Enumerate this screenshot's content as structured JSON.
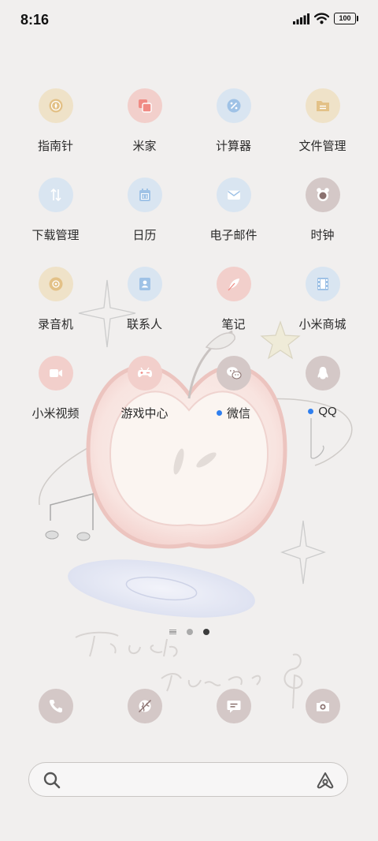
{
  "status_bar": {
    "time": "8:16",
    "battery": "100"
  },
  "apps": [
    {
      "name": "compass",
      "label": "指南针",
      "icon": "compass-icon",
      "bg": "#efe2c8",
      "fg": "#e3c187",
      "dot": false
    },
    {
      "name": "mi-home",
      "label": "米家",
      "icon": "mi-home-icon",
      "bg": "#f2cfcb",
      "fg": "#f08b84",
      "dot": false
    },
    {
      "name": "calculator",
      "label": "计算器",
      "icon": "calculator-icon",
      "bg": "#d9e5f1",
      "fg": "#9fc2e6",
      "dot": false
    },
    {
      "name": "file-manager",
      "label": "文件管理",
      "icon": "folder-icon",
      "bg": "#efe2c8",
      "fg": "#e3c187",
      "dot": false
    },
    {
      "name": "download-manager",
      "label": "下载管理",
      "icon": "download-icon",
      "bg": "#d9e5f1",
      "fg": "#9fc2e6",
      "dot": false
    },
    {
      "name": "calendar",
      "label": "日历",
      "icon": "calendar-icon",
      "bg": "#d9e5f1",
      "fg": "#9fc2e6",
      "dot": false
    },
    {
      "name": "email",
      "label": "电子邮件",
      "icon": "mail-icon",
      "bg": "#d9e5f1",
      "fg": "#9fc2e6",
      "dot": false
    },
    {
      "name": "clock",
      "label": "时钟",
      "icon": "alarm-clock-icon",
      "bg": "#d4c8c7",
      "fg": "#8b7270",
      "dot": false
    },
    {
      "name": "recorder",
      "label": "录音机",
      "icon": "recorder-icon",
      "bg": "#efe2c8",
      "fg": "#e3c187",
      "dot": false
    },
    {
      "name": "contacts",
      "label": "联系人",
      "icon": "contacts-icon",
      "bg": "#d9e5f1",
      "fg": "#9fc2e6",
      "dot": false
    },
    {
      "name": "notes",
      "label": "笔记",
      "icon": "feather-icon",
      "bg": "#f2cfcb",
      "fg": "#f08b84",
      "dot": false
    },
    {
      "name": "mi-store",
      "label": "小米商城",
      "icon": "film-icon",
      "bg": "#d9e5f1",
      "fg": "#9fc2e6",
      "dot": false
    },
    {
      "name": "mi-video",
      "label": "小米视频",
      "icon": "video-camera-icon",
      "bg": "#f2cfcb",
      "fg": "#f08b84",
      "dot": false
    },
    {
      "name": "game-center",
      "label": "游戏中心",
      "icon": "gamepad-icon",
      "bg": "#f2cfcb",
      "fg": "#f08b84",
      "dot": false
    },
    {
      "name": "wechat",
      "label": "微信",
      "icon": "wechat-icon",
      "bg": "#d4c8c7",
      "fg": "#8b7270",
      "dot": true
    },
    {
      "name": "qq",
      "label": "QQ",
      "icon": "qq-penguin-icon",
      "bg": "#d4c8c7",
      "fg": "#8b7270",
      "dot": true
    }
  ],
  "page_indicator": {
    "pages": 2,
    "active_page": 2
  },
  "dock": [
    {
      "name": "phone",
      "icon": "phone-icon",
      "bg": "#d4c8c7",
      "fg": "#8b7270"
    },
    {
      "name": "browser",
      "icon": "browser-icon",
      "bg": "#d4c8c7",
      "fg": "#8b7270"
    },
    {
      "name": "messages",
      "icon": "message-icon",
      "bg": "#d4c8c7",
      "fg": "#8b7270"
    },
    {
      "name": "camera",
      "icon": "camera-icon",
      "bg": "#d4c8c7",
      "fg": "#8b7270"
    }
  ],
  "search": {
    "placeholder": ""
  }
}
